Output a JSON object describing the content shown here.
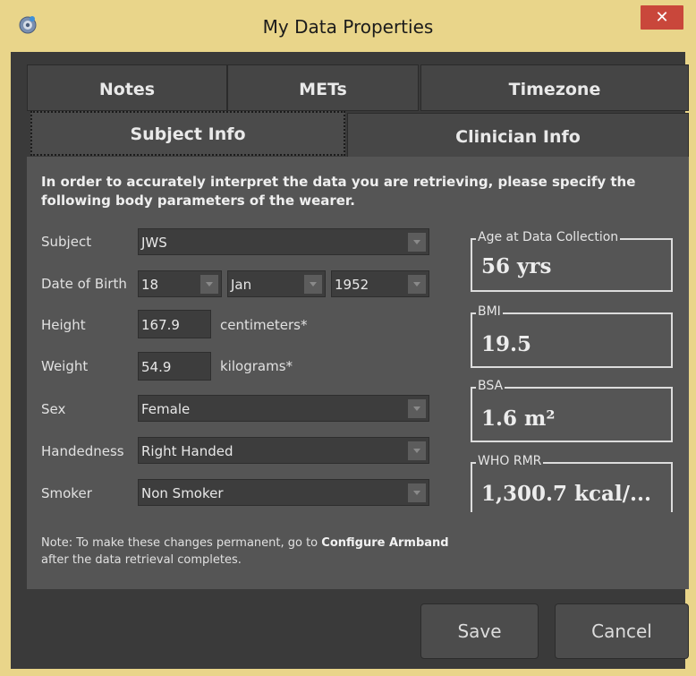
{
  "window": {
    "title": "My Data Properties",
    "close_glyph": "✕"
  },
  "tabs": {
    "row1": [
      {
        "label": "Notes"
      },
      {
        "label": "METs"
      },
      {
        "label": "Timezone"
      }
    ],
    "row2": [
      {
        "label": "Subject Info",
        "active": true
      },
      {
        "label": "Clinician Info"
      }
    ]
  },
  "form": {
    "intro": "In order to accurately interpret the data you are retrieving, please specify the following body parameters of the wearer.",
    "subject": {
      "label": "Subject",
      "value": "JWS"
    },
    "dob": {
      "label": "Date of Birth",
      "day": "18",
      "month": "Jan",
      "year": "1952"
    },
    "height": {
      "label": "Height",
      "value": "167.9",
      "unit": "centimeters*"
    },
    "weight": {
      "label": "Weight",
      "value": "54.9",
      "unit": "kilograms*"
    },
    "sex": {
      "label": "Sex",
      "value": "Female"
    },
    "handedness": {
      "label": "Handedness",
      "value": "Right Handed"
    },
    "smoker": {
      "label": "Smoker",
      "value": "Non Smoker"
    }
  },
  "metrics": {
    "age": {
      "label": "Age at Data Collection",
      "value": "56 yrs"
    },
    "bmi": {
      "label": "BMI",
      "value": "19.5"
    },
    "bsa": {
      "label": "BSA",
      "value": "1.6 m²"
    },
    "rmr": {
      "label": "WHO RMR",
      "value": "1,300.7 kcal/..."
    }
  },
  "note": {
    "prefix": "Note: To make these changes permanent, go to",
    "link": "Configure Armband",
    "suffix": "after the data retrieval completes."
  },
  "buttons": {
    "save": "Save",
    "cancel": "Cancel"
  },
  "colors": {
    "titlebar": "#e9d58a",
    "close": "#c9473b",
    "panel": "#555555",
    "client": "#3a3a3a"
  }
}
